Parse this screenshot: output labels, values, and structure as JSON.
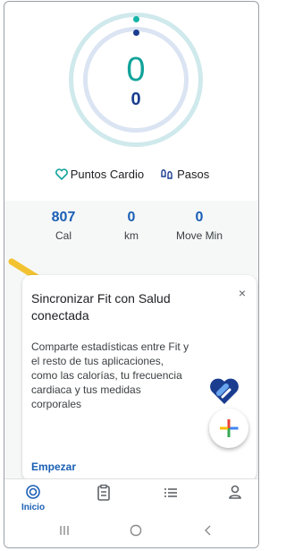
{
  "summary": {
    "points_value": "0",
    "steps_value": "0"
  },
  "legend": {
    "points_label": "Puntos Cardio",
    "steps_label": "Pasos"
  },
  "stats": [
    {
      "value": "807",
      "label": "Cal"
    },
    {
      "value": "0",
      "label": "km"
    },
    {
      "value": "0",
      "label": "Move Min"
    }
  ],
  "card": {
    "title": "Sincronizar Fit con Salud conectada",
    "close": "×",
    "body": "Comparte estadísticas entre Fit y el resto de tus aplicaciones, como las calorías, tu frecuencia cardiaca y tus medidas corporales",
    "action": "Empezar"
  },
  "nav": {
    "home_label": "Inicio"
  },
  "colors": {
    "teal": "#12a39a",
    "blue": "#1a3d8f",
    "accent": "#1a5fb4",
    "arrow": "#f2c230"
  },
  "icons": [
    "heart-icon",
    "shoes-icon",
    "close-icon",
    "health-connect-logo",
    "add-icon",
    "home-icon",
    "journal-icon",
    "list-icon",
    "profile-icon",
    "recents-icon",
    "home-circle-icon",
    "back-icon"
  ]
}
